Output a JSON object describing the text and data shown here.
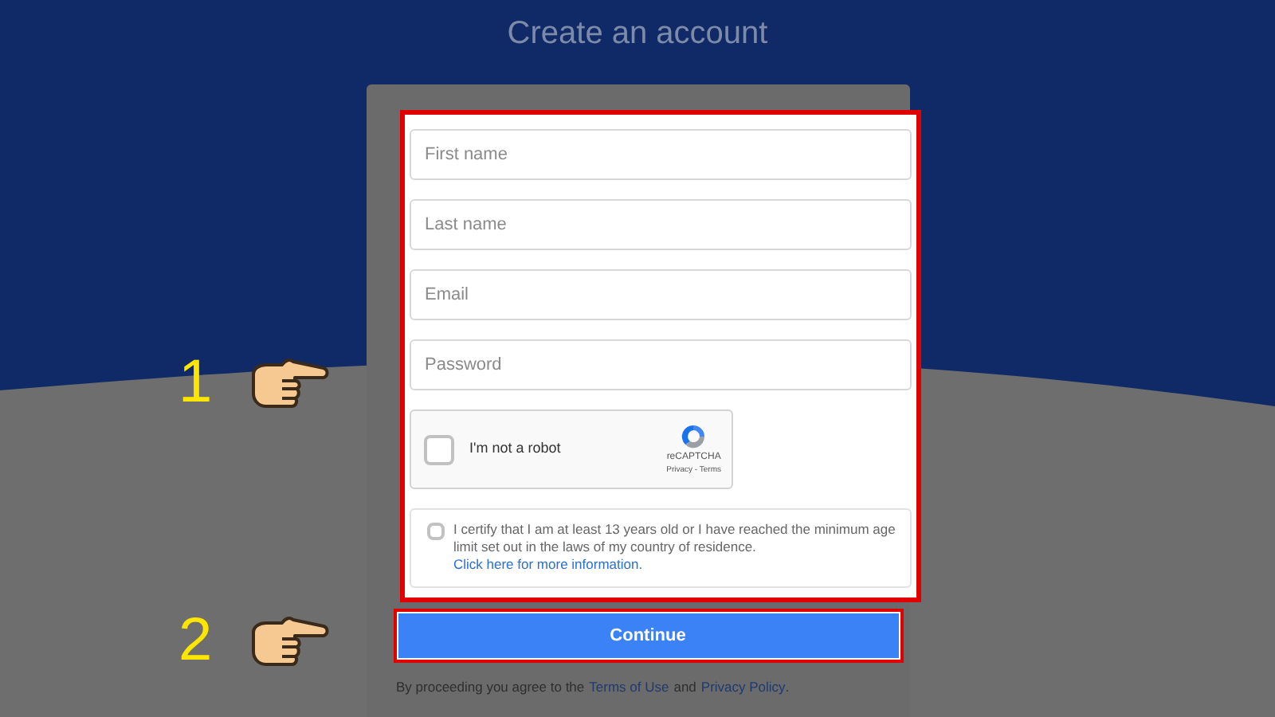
{
  "title": "Create an account",
  "fields": [
    {
      "placeholder": "First name"
    },
    {
      "placeholder": "Last name"
    },
    {
      "placeholder": "Email"
    },
    {
      "placeholder": "Password"
    }
  ],
  "captcha": {
    "label": "I'm not a robot",
    "checked": false,
    "brand": "reCAPTCHA",
    "links": "Privacy - Terms"
  },
  "certify": {
    "checked": false,
    "text": "I certify that I am at least 13 years old or I have reached the minimum age limit set out in the laws of my country of residence.",
    "link": "Click here for more information."
  },
  "continue_button": "Continue",
  "footer": {
    "prefix": "By proceeding you agree to the",
    "terms_link": "Terms of Use",
    "middle": "and",
    "privacy_link": "Privacy Policy",
    "suffix": "."
  },
  "annotations": [
    {
      "number": "1"
    },
    {
      "number": "2"
    }
  ]
}
